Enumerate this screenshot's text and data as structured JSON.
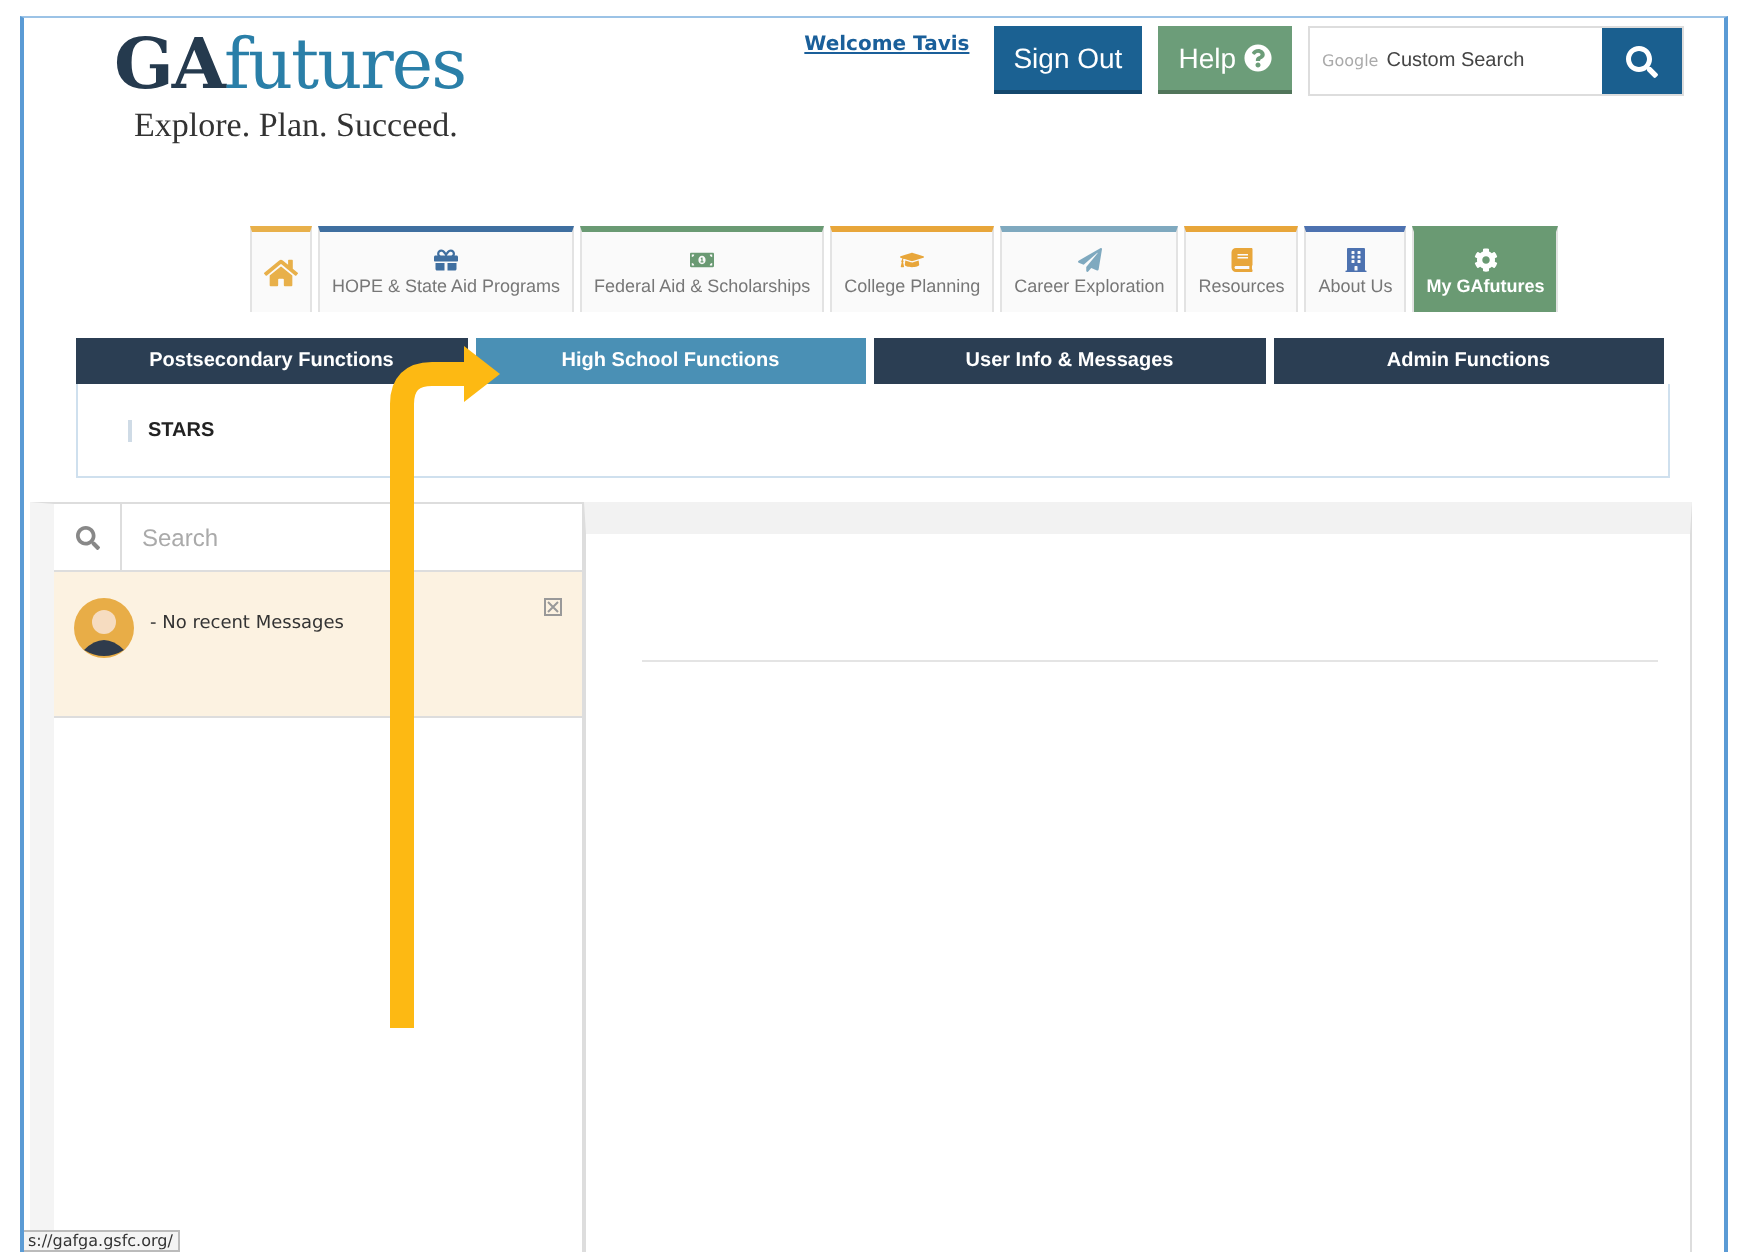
{
  "logo": {
    "bold": "GA",
    "light": "futures",
    "tagline": "Explore. Plan. Succeed."
  },
  "header": {
    "welcome": "Welcome Tavis",
    "sign_out": "Sign Out",
    "help": "Help",
    "search": {
      "brand": "Google",
      "placeholder": "Custom Search"
    }
  },
  "nav_tabs": [
    {
      "kind": "home",
      "color": "#e8b04a",
      "selected": false
    },
    {
      "kind": "gift",
      "label": "HOPE & State Aid Programs",
      "color": "#3f6fa0",
      "selected": false
    },
    {
      "kind": "money",
      "label": "Federal Aid & Scholarships",
      "color": "#6a9a73",
      "selected": false
    },
    {
      "kind": "cap",
      "label": "College Planning",
      "color": "#e8a63a",
      "selected": false
    },
    {
      "kind": "plane",
      "label": "Career Exploration",
      "color": "#7fa9bf",
      "selected": false
    },
    {
      "kind": "book",
      "label": "Resources",
      "color": "#e8a63a",
      "selected": false
    },
    {
      "kind": "building",
      "label": "About Us",
      "color": "#4d72b0",
      "selected": false
    },
    {
      "kind": "gear",
      "label": "My GAfutures",
      "color": "#6a9a73",
      "selected": true
    }
  ],
  "sub_tabs": [
    {
      "label": "Postsecondary Functions",
      "selected": false
    },
    {
      "label": "High School Functions",
      "selected": true
    },
    {
      "label": "User Info & Messages",
      "selected": false
    },
    {
      "label": "Admin Functions",
      "selected": false
    }
  ],
  "sub_menu": [
    "STARS"
  ],
  "messages": {
    "search_placeholder": "Search",
    "items": [
      {
        "text": "- No recent Messages"
      }
    ]
  },
  "status_url": "s://gafga.gsfc.org/"
}
